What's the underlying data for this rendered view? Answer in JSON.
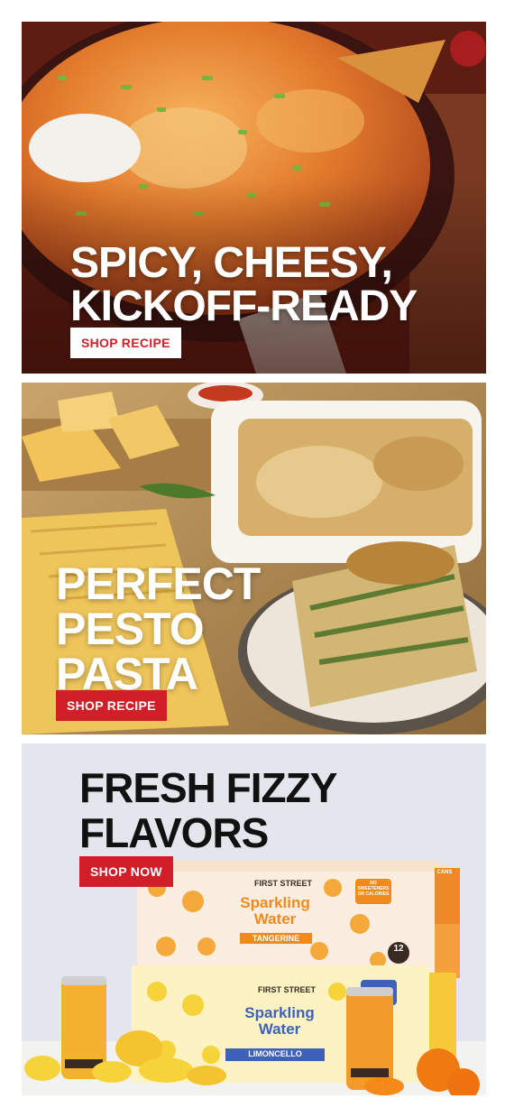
{
  "promos": [
    {
      "headline": "SPICY, CHEESY,\nKICKOFF-READY",
      "cta": "SHOP RECIPE"
    },
    {
      "headline": "PERFECT\nPESTO\nPASTA",
      "cta": "SHOP RECIPE"
    },
    {
      "headline": "FRESH FIZZY\nFLAVORS",
      "cta": "SHOP NOW",
      "packaging": {
        "brand": "FIRST STREET",
        "product": "Sparkling Water",
        "flavor_top": "TANGERINE",
        "flavor_bottom": "LIMONCELLO",
        "count": "12",
        "count_unit": "CANS",
        "badge": "NO SWEETENERS OR CALORIES"
      }
    }
  ],
  "colors": {
    "accent_red": "#d11f2a",
    "headline_dark": "#111111",
    "tangerine": "#f08a1c",
    "lemon": "#f7d33a"
  }
}
